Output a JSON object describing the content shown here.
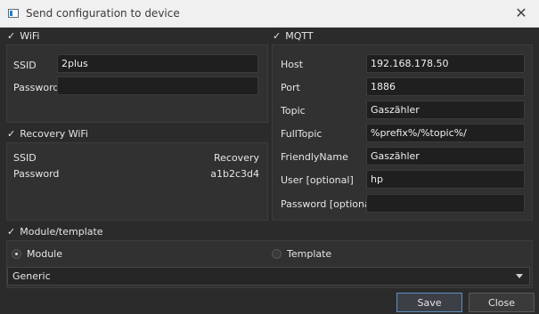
{
  "window": {
    "title": "Send configuration to device"
  },
  "wifi": {
    "header": "WiFi",
    "ssid_label": "SSID",
    "ssid_value": "2plus",
    "password_label": "Password",
    "password_value": ""
  },
  "recovery_wifi": {
    "header": "Recovery WiFi",
    "ssid_label": "SSID",
    "ssid_value": "Recovery",
    "password_label": "Password",
    "password_value": "a1b2c3d4"
  },
  "mqtt": {
    "header": "MQTT",
    "rows": [
      {
        "label": "Host",
        "value": "192.168.178.50"
      },
      {
        "label": "Port",
        "value": "1886"
      },
      {
        "label": "Topic",
        "value": "Gaszähler"
      },
      {
        "label": "FullTopic",
        "value": "%prefix%/%topic%/"
      },
      {
        "label": "FriendlyName",
        "value": "Gaszähler"
      },
      {
        "label": "User [optional]",
        "value": "hp"
      },
      {
        "label": "Password [optional]",
        "value": ""
      }
    ]
  },
  "module_template": {
    "header": "Module/template",
    "module_label": "Module",
    "template_label": "Template",
    "selected": "Module",
    "combo_value": "Generic"
  },
  "buttons": {
    "save": "Save",
    "close": "Close"
  },
  "icons": {
    "window": "window-icon",
    "close": "close-icon",
    "check": "checkmark-icon",
    "dropdown": "chevron-down-icon"
  }
}
